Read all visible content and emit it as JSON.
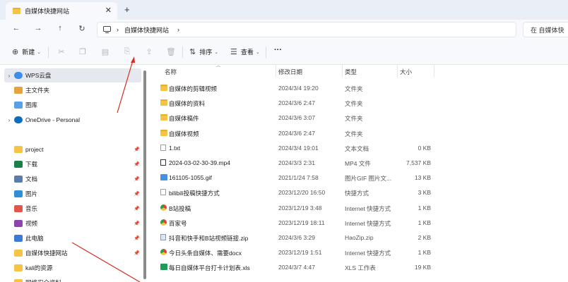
{
  "tab": {
    "title": "自媒体快捷网站",
    "close": "✕",
    "new_tab": "+"
  },
  "nav_buttons": {
    "back": "←",
    "forward": "→",
    "up": "↑",
    "refresh": "↻"
  },
  "address": {
    "separator": "›",
    "segments": [
      "自媒体快捷网站",
      ""
    ]
  },
  "search": {
    "placeholder": "在 自媒体快"
  },
  "toolbar": {
    "new_label": "新建",
    "sort_label": "排序",
    "view_label": "查看",
    "more_label": "···"
  },
  "nav_pane": {
    "items": [
      {
        "label": "WPS云盘",
        "icon": "cloud-icon",
        "selected": true,
        "expand": true,
        "pinned": false
      },
      {
        "label": "主文件夹",
        "icon": "home-icon",
        "selected": false,
        "expand": false,
        "pinned": false
      },
      {
        "label": "图库",
        "icon": "gallery-icon",
        "selected": false,
        "expand": false,
        "pinned": false
      },
      {
        "label": "OneDrive - Personal",
        "icon": "onedrive-icon",
        "selected": false,
        "expand": true,
        "pinned": false
      },
      {
        "label": "project",
        "icon": "folder-icon",
        "selected": false,
        "expand": false,
        "pinned": true
      },
      {
        "label": "下载",
        "icon": "download-icon",
        "selected": false,
        "expand": false,
        "pinned": true
      },
      {
        "label": "文档",
        "icon": "document-icon",
        "selected": false,
        "expand": false,
        "pinned": true
      },
      {
        "label": "图片",
        "icon": "picture-icon",
        "selected": false,
        "expand": false,
        "pinned": true
      },
      {
        "label": "音乐",
        "icon": "music-icon",
        "selected": false,
        "expand": false,
        "pinned": true
      },
      {
        "label": "视频",
        "icon": "video-icon",
        "selected": false,
        "expand": false,
        "pinned": true
      },
      {
        "label": "此电脑",
        "icon": "computer-icon",
        "selected": false,
        "expand": false,
        "pinned": true
      },
      {
        "label": "自媒体快捷网站",
        "icon": "folder-icon",
        "selected": false,
        "expand": false,
        "pinned": true
      },
      {
        "label": "kali的资源",
        "icon": "folder-icon",
        "selected": false,
        "expand": false,
        "pinned": false
      },
      {
        "label": "网络安全资料",
        "icon": "folder-icon",
        "selected": false,
        "expand": false,
        "pinned": false
      }
    ]
  },
  "columns": {
    "name": "名称",
    "date": "修改日期",
    "type": "类型",
    "size": "大小"
  },
  "files": [
    {
      "name": "自媒体的剪辑视频",
      "date": "2024/3/4 19:20",
      "type": "文件夹",
      "size": "",
      "icon": "folder"
    },
    {
      "name": "自媒体的资料",
      "date": "2024/3/6 2:47",
      "type": "文件夹",
      "size": "",
      "icon": "folder"
    },
    {
      "name": "自媒体稿件",
      "date": "2024/3/6 3:07",
      "type": "文件夹",
      "size": "",
      "icon": "folder"
    },
    {
      "name": "自媒体视频",
      "date": "2024/3/6 2:47",
      "type": "文件夹",
      "size": "",
      "icon": "folder"
    },
    {
      "name": "1.txt",
      "date": "2024/3/4 19:01",
      "type": "文本文档",
      "size": "0 KB",
      "icon": "file"
    },
    {
      "name": "2024-03-02-30-39.mp4",
      "date": "2024/3/3 2:31",
      "type": "MP4 文件",
      "size": "7,537 KB",
      "icon": "mp4"
    },
    {
      "name": "161105-1055.gif",
      "date": "2021/1/24 7:58",
      "type": "图片GIF 图片文...",
      "size": "13 KB",
      "icon": "gif"
    },
    {
      "name": "bilibili投稿快捷方式",
      "date": "2023/12/20 16:50",
      "type": "快捷方式",
      "size": "3 KB",
      "icon": "file"
    },
    {
      "name": "B站投稿",
      "date": "2023/12/19 3:48",
      "type": "Internet 快捷方式",
      "size": "1 KB",
      "icon": "chrome"
    },
    {
      "name": "百家号",
      "date": "2023/12/19 18:11",
      "type": "Internet 快捷方式",
      "size": "1 KB",
      "icon": "chrome"
    },
    {
      "name": "抖音和快手和B站视频链接.zip",
      "date": "2024/3/6 3:29",
      "type": "HaoZip.zip",
      "size": "2 KB",
      "icon": "zip"
    },
    {
      "name": "今日头条自媒体、需要docx",
      "date": "2023/12/19 1:51",
      "type": "Internet 快捷方式",
      "size": "1 KB",
      "icon": "chrome"
    },
    {
      "name": "每日自媒体平台打卡计划表.xls",
      "date": "2024/3/7 4:47",
      "type": "XLS 工作表",
      "size": "19 KB",
      "icon": "xls"
    }
  ],
  "colors": {
    "accent": "#0067c0",
    "annotation": "#d62d20",
    "folder": "#f6c445"
  }
}
